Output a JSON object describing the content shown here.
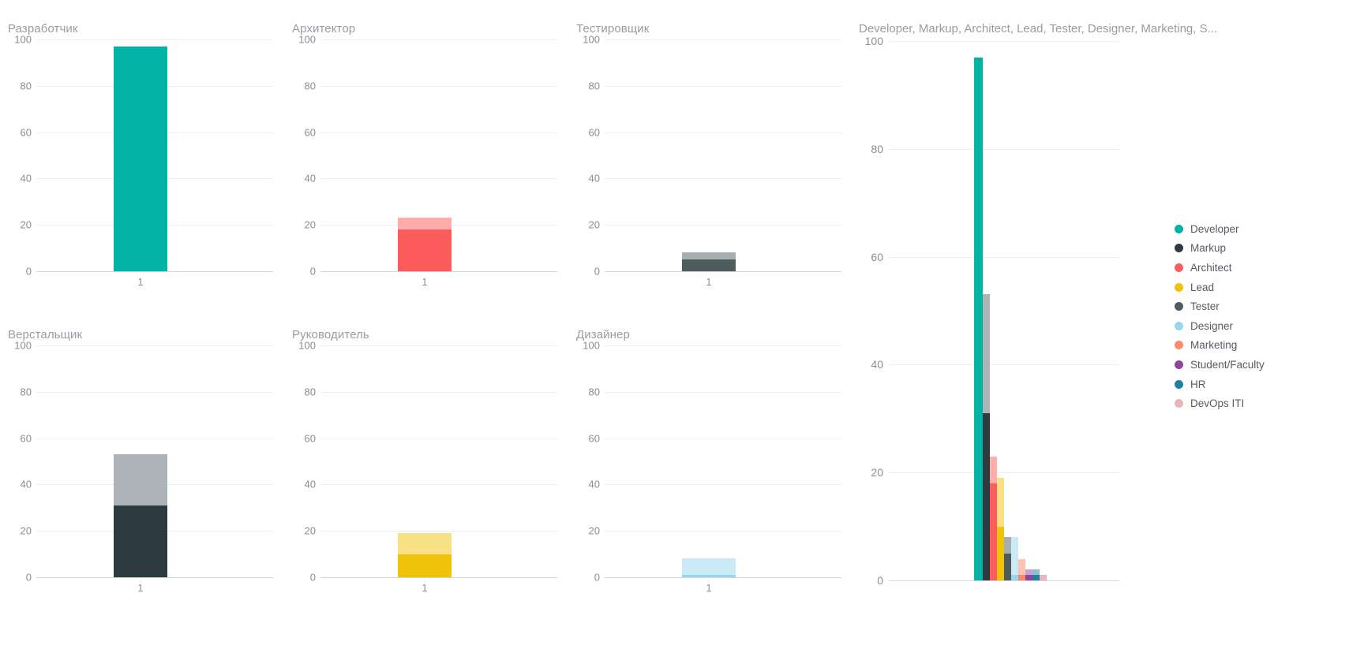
{
  "palette": {
    "developer": "#00b3a4",
    "markup": "#2d3a3f",
    "architect": "#fd5c5c",
    "lead": "#f0c30b",
    "tester": "#4e5c5e",
    "designer": "#95d7ec",
    "marketing": "#fb8a67",
    "student_faculty": "#90459a",
    "hr": "#2080a0",
    "devops_iti": "#eab4bb",
    "developer_light": "#7fd9d2",
    "markup_light": "#adb4b7",
    "architect_light": "#feadad",
    "lead_light": "#f8e185",
    "tester_light": "#a6aeaf",
    "designer_light": "#caebf5",
    "marketing_light": "#fdc4b3",
    "student_faculty_light": "#c7a2cc",
    "hr_light": "#8fbfcf",
    "devops_iti_light": "#f4d9dd",
    "gridline": "#eeeeee",
    "axis": "#d6d6d6",
    "title_text": "#9b9ba3",
    "tick_text": "#8c8c94",
    "legend_text": "#595963"
  },
  "small_multiples": [
    {
      "title": "Разработчик",
      "x_label": "1",
      "y_ticks": [
        "100",
        "80",
        "60",
        "40",
        "20",
        "0"
      ],
      "base_color_key": "developer",
      "light_color_key": "developer_light",
      "value_dark": 97,
      "value_light": 97
    },
    {
      "title": "Архитектор",
      "x_label": "1",
      "y_ticks": [
        "100",
        "80",
        "60",
        "40",
        "20",
        "0"
      ],
      "base_color_key": "architect",
      "light_color_key": "architect_light",
      "value_dark": 18,
      "value_light": 23
    },
    {
      "title": "Тестировщик",
      "x_label": "1",
      "y_ticks": [
        "100",
        "80",
        "60",
        "40",
        "20",
        "0"
      ],
      "base_color_key": "tester",
      "light_color_key": "tester_light",
      "value_dark": 5,
      "value_light": 8
    },
    {
      "title": "Верстальщик",
      "x_label": "1",
      "y_ticks": [
        "100",
        "80",
        "60",
        "40",
        "20",
        "0"
      ],
      "base_color_key": "markup",
      "light_color_key": "markup_light",
      "value_dark": 31,
      "value_light": 53
    },
    {
      "title": "Руководитель",
      "x_label": "1",
      "y_ticks": [
        "100",
        "80",
        "60",
        "40",
        "20",
        "0"
      ],
      "base_color_key": "lead",
      "light_color_key": "lead_light",
      "value_dark": 10,
      "value_light": 19
    },
    {
      "title": "Дизайнер",
      "x_label": "1",
      "y_ticks": [
        "100",
        "80",
        "60",
        "40",
        "20",
        "0"
      ],
      "base_color_key": "designer",
      "light_color_key": "designer_light",
      "value_dark": 1,
      "value_light": 8
    }
  ],
  "combined": {
    "title": "Developer, Markup, Architect, Lead, Tester, Designer, Marketing, S...",
    "y_ticks": [
      "100",
      "80",
      "60",
      "40",
      "20",
      "0"
    ],
    "legend": [
      {
        "label": "Developer",
        "color_key": "developer"
      },
      {
        "label": "Markup",
        "color_key": "markup"
      },
      {
        "label": "Architect",
        "color_key": "architect"
      },
      {
        "label": "Lead",
        "color_key": "lead"
      },
      {
        "label": "Tester",
        "color_key": "tester"
      },
      {
        "label": "Designer",
        "color_key": "designer"
      },
      {
        "label": "Marketing",
        "color_key": "marketing"
      },
      {
        "label": "Student/Faculty",
        "color_key": "student_faculty"
      },
      {
        "label": "HR",
        "color_key": "hr"
      },
      {
        "label": "DevOps ITI",
        "color_key": "devops_iti"
      }
    ]
  },
  "chart_data": {
    "type": "bar",
    "title": "Developer, Markup, Architect, Lead, Tester, Designer, Marketing, S...",
    "subtitle": "",
    "xlabel": "1",
    "ylabel": "",
    "ylim": [
      0,
      100
    ],
    "yticks": [
      0,
      20,
      40,
      60,
      80,
      100
    ],
    "grid": true,
    "legend_position": "right",
    "categories": [
      "1"
    ],
    "stacked": true,
    "series": [
      {
        "name": "Developer",
        "russian_name": "Разработчик",
        "dark_value": 97,
        "light_value": 97,
        "color": "#00b3a4",
        "light_color": "#7fd9d2"
      },
      {
        "name": "Markup",
        "russian_name": "Верстальщик",
        "dark_value": 31,
        "light_value": 53,
        "color": "#2d3a3f",
        "light_color": "#adb4b7"
      },
      {
        "name": "Architect",
        "russian_name": "Архитектор",
        "dark_value": 18,
        "light_value": 23,
        "color": "#fd5c5c",
        "light_color": "#feadad"
      },
      {
        "name": "Lead",
        "russian_name": "Руководитель",
        "dark_value": 10,
        "light_value": 19,
        "color": "#f0c30b",
        "light_color": "#f8e185"
      },
      {
        "name": "Tester",
        "russian_name": "Тестировщик",
        "dark_value": 5,
        "light_value": 8,
        "color": "#4e5c5e",
        "light_color": "#a6aeaf"
      },
      {
        "name": "Designer",
        "russian_name": "Дизайнер",
        "dark_value": 1,
        "light_value": 8,
        "color": "#95d7ec",
        "light_color": "#caebf5"
      },
      {
        "name": "Marketing",
        "russian_name": "",
        "dark_value": 1,
        "light_value": 4,
        "color": "#fb8a67",
        "light_color": "#fdc4b3"
      },
      {
        "name": "Student/Faculty",
        "russian_name": "",
        "dark_value": 1,
        "light_value": 2,
        "color": "#90459a",
        "light_color": "#c7a2cc"
      },
      {
        "name": "HR",
        "russian_name": "",
        "dark_value": 1,
        "light_value": 2,
        "color": "#2080a0",
        "light_color": "#8fbfcf"
      },
      {
        "name": "DevOps ITI",
        "russian_name": "",
        "dark_value": 1,
        "light_value": 1,
        "color": "#eab4bb",
        "light_color": "#f4d9dd"
      }
    ]
  }
}
